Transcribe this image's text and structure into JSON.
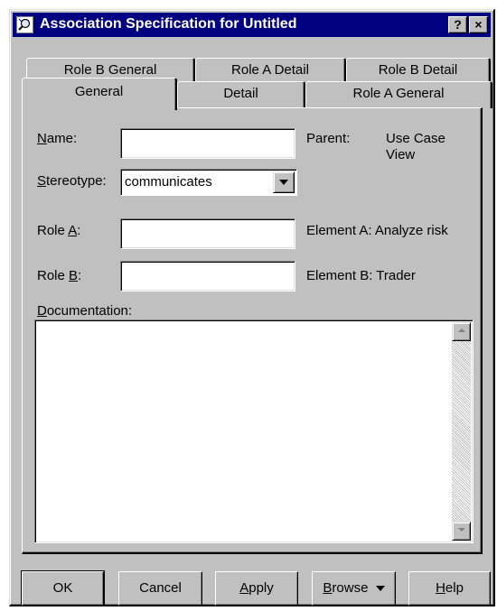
{
  "window": {
    "title": "Association Specification for Untitled",
    "help_label": "?",
    "close_label": "×"
  },
  "tabs": {
    "row1": [
      {
        "label": "Role B General"
      },
      {
        "label": "Role A Detail"
      },
      {
        "label": "Role B Detail"
      }
    ],
    "row2": [
      {
        "label": "General",
        "active": true
      },
      {
        "label": "Detail"
      },
      {
        "label": "Role A General"
      }
    ]
  },
  "form": {
    "name_label_u": "N",
    "name_label_rest": "ame:",
    "name_value": "",
    "parent_label": "Parent:",
    "parent_value": "Use Case View",
    "stereotype_label_u": "S",
    "stereotype_label_rest": "tereotype:",
    "stereotype_value": "communicates",
    "role_a_label_pre": "Role ",
    "role_a_label_u": "A",
    "role_a_label_post": ":",
    "role_a_value": "",
    "element_a": "Element A: Analyze risk",
    "role_b_label_pre": "Role ",
    "role_b_label_u": "B",
    "role_b_label_post": ":",
    "role_b_value": "",
    "element_b": "Element B: Trader",
    "documentation_label_u": "D",
    "documentation_label_rest": "ocumentation:",
    "documentation_value": ""
  },
  "buttons": {
    "ok": "OK",
    "cancel": "Cancel",
    "apply_u": "A",
    "apply_rest": "pply",
    "browse_u": "B",
    "browse_rest": "rowse",
    "help_u": "H",
    "help_rest": "elp"
  },
  "icons": {
    "title": "magnifier-icon",
    "combo_arrow": "chevron-down-icon",
    "scroll_up": "scroll-up-arrow-icon",
    "scroll_down": "scroll-down-arrow-icon"
  },
  "colors": {
    "titlebar": "#000080",
    "face": "#c0c0c0"
  }
}
